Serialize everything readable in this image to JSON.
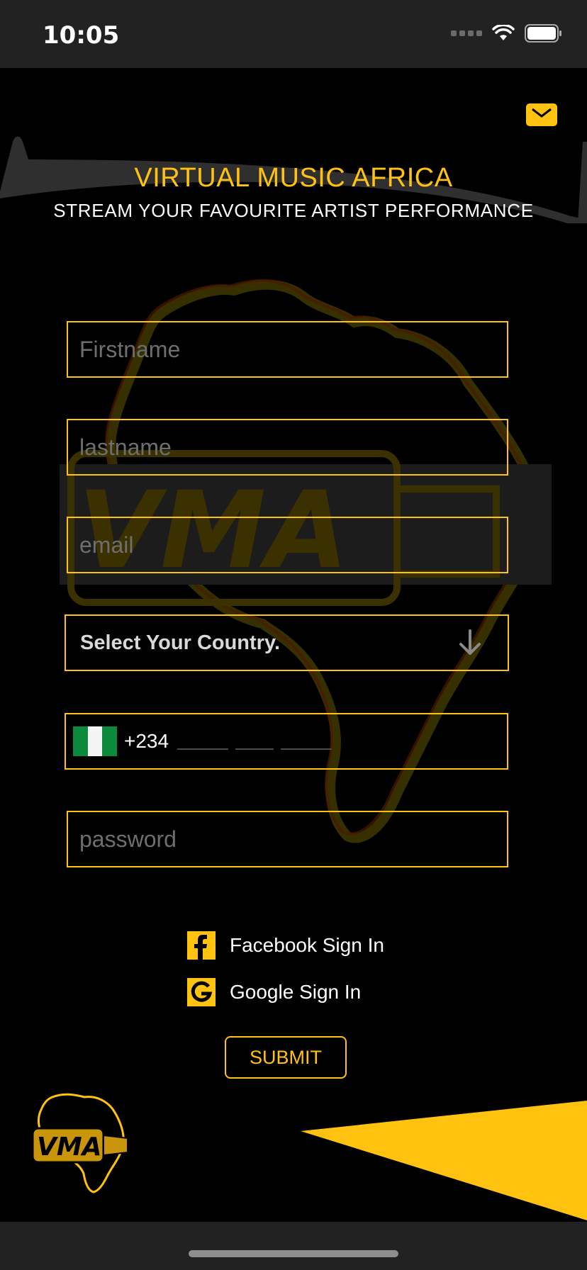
{
  "status_bar": {
    "time": "10:05"
  },
  "header": {
    "title": "VIRTUAL MUSIC AFRICA",
    "subtitle": "STREAM YOUR FAVOURITE ARTIST PERFORMANCE",
    "mail_icon": "mail-icon"
  },
  "form": {
    "firstname_placeholder": "Firstname",
    "lastname_placeholder": "lastname",
    "email_placeholder": "email",
    "country_label": "Select Your Country.",
    "country_arrow_icon": "arrow-down-icon",
    "phone": {
      "flag_icon": "nigeria-flag-icon",
      "dial_code": "+234"
    },
    "password_placeholder": "password"
  },
  "social": {
    "facebook_label": "Facebook Sign In",
    "facebook_icon": "facebook-icon",
    "google_label": "Google Sign In",
    "google_icon": "google-icon"
  },
  "submit_label": "SUBMIT",
  "colors": {
    "accent": "#ffc20e",
    "background": "#000000",
    "bar": "#222222",
    "placeholder": "#6e6e6e"
  }
}
